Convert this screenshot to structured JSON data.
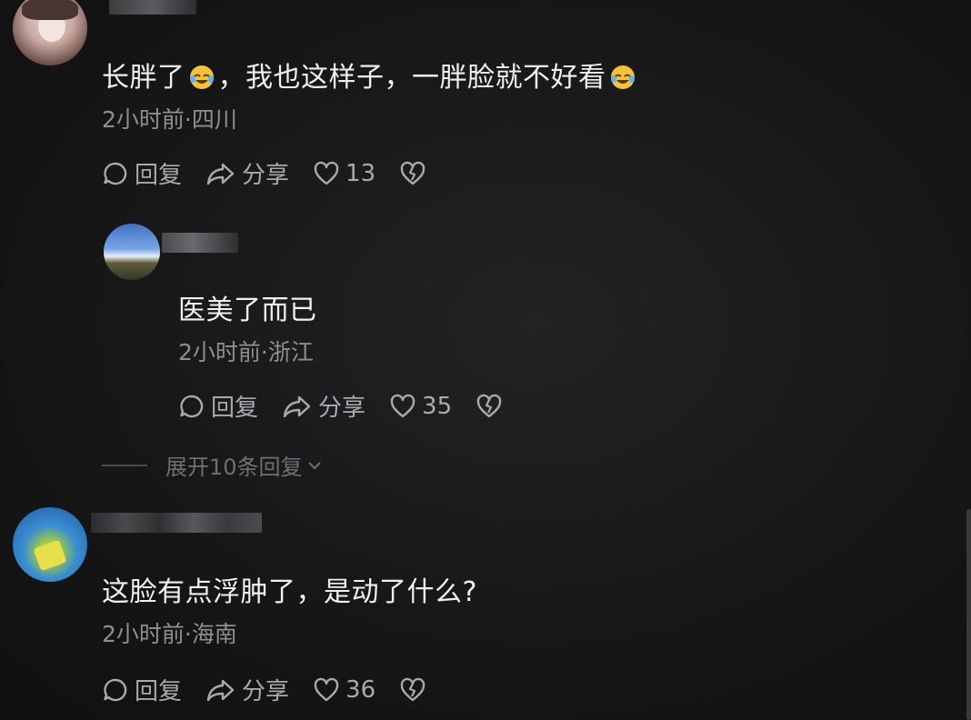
{
  "comments": [
    {
      "text_a": "长胖了",
      "text_b": "，我也这样子，一胖脸就不好看",
      "meta": "2小时前·四川",
      "reply_label": "回复",
      "share_label": "分享",
      "likes": "13"
    },
    {
      "text": "医美了而已",
      "meta": "2小时前·浙江",
      "reply_label": "回复",
      "share_label": "分享",
      "likes": "35"
    },
    {
      "text": "这脸有点浮肿了，是动了什么?",
      "meta": "2小时前·海南",
      "reply_label": "回复",
      "share_label": "分享",
      "likes": "36"
    }
  ],
  "expand_replies_label": "展开10条回复",
  "icons": {
    "reply": "comment-bubble-icon",
    "share": "share-arrow-icon",
    "like": "heart-icon",
    "dislike": "broken-heart-icon",
    "emoji": "laughing-tears-emoji",
    "expand": "chevron-down-icon"
  }
}
